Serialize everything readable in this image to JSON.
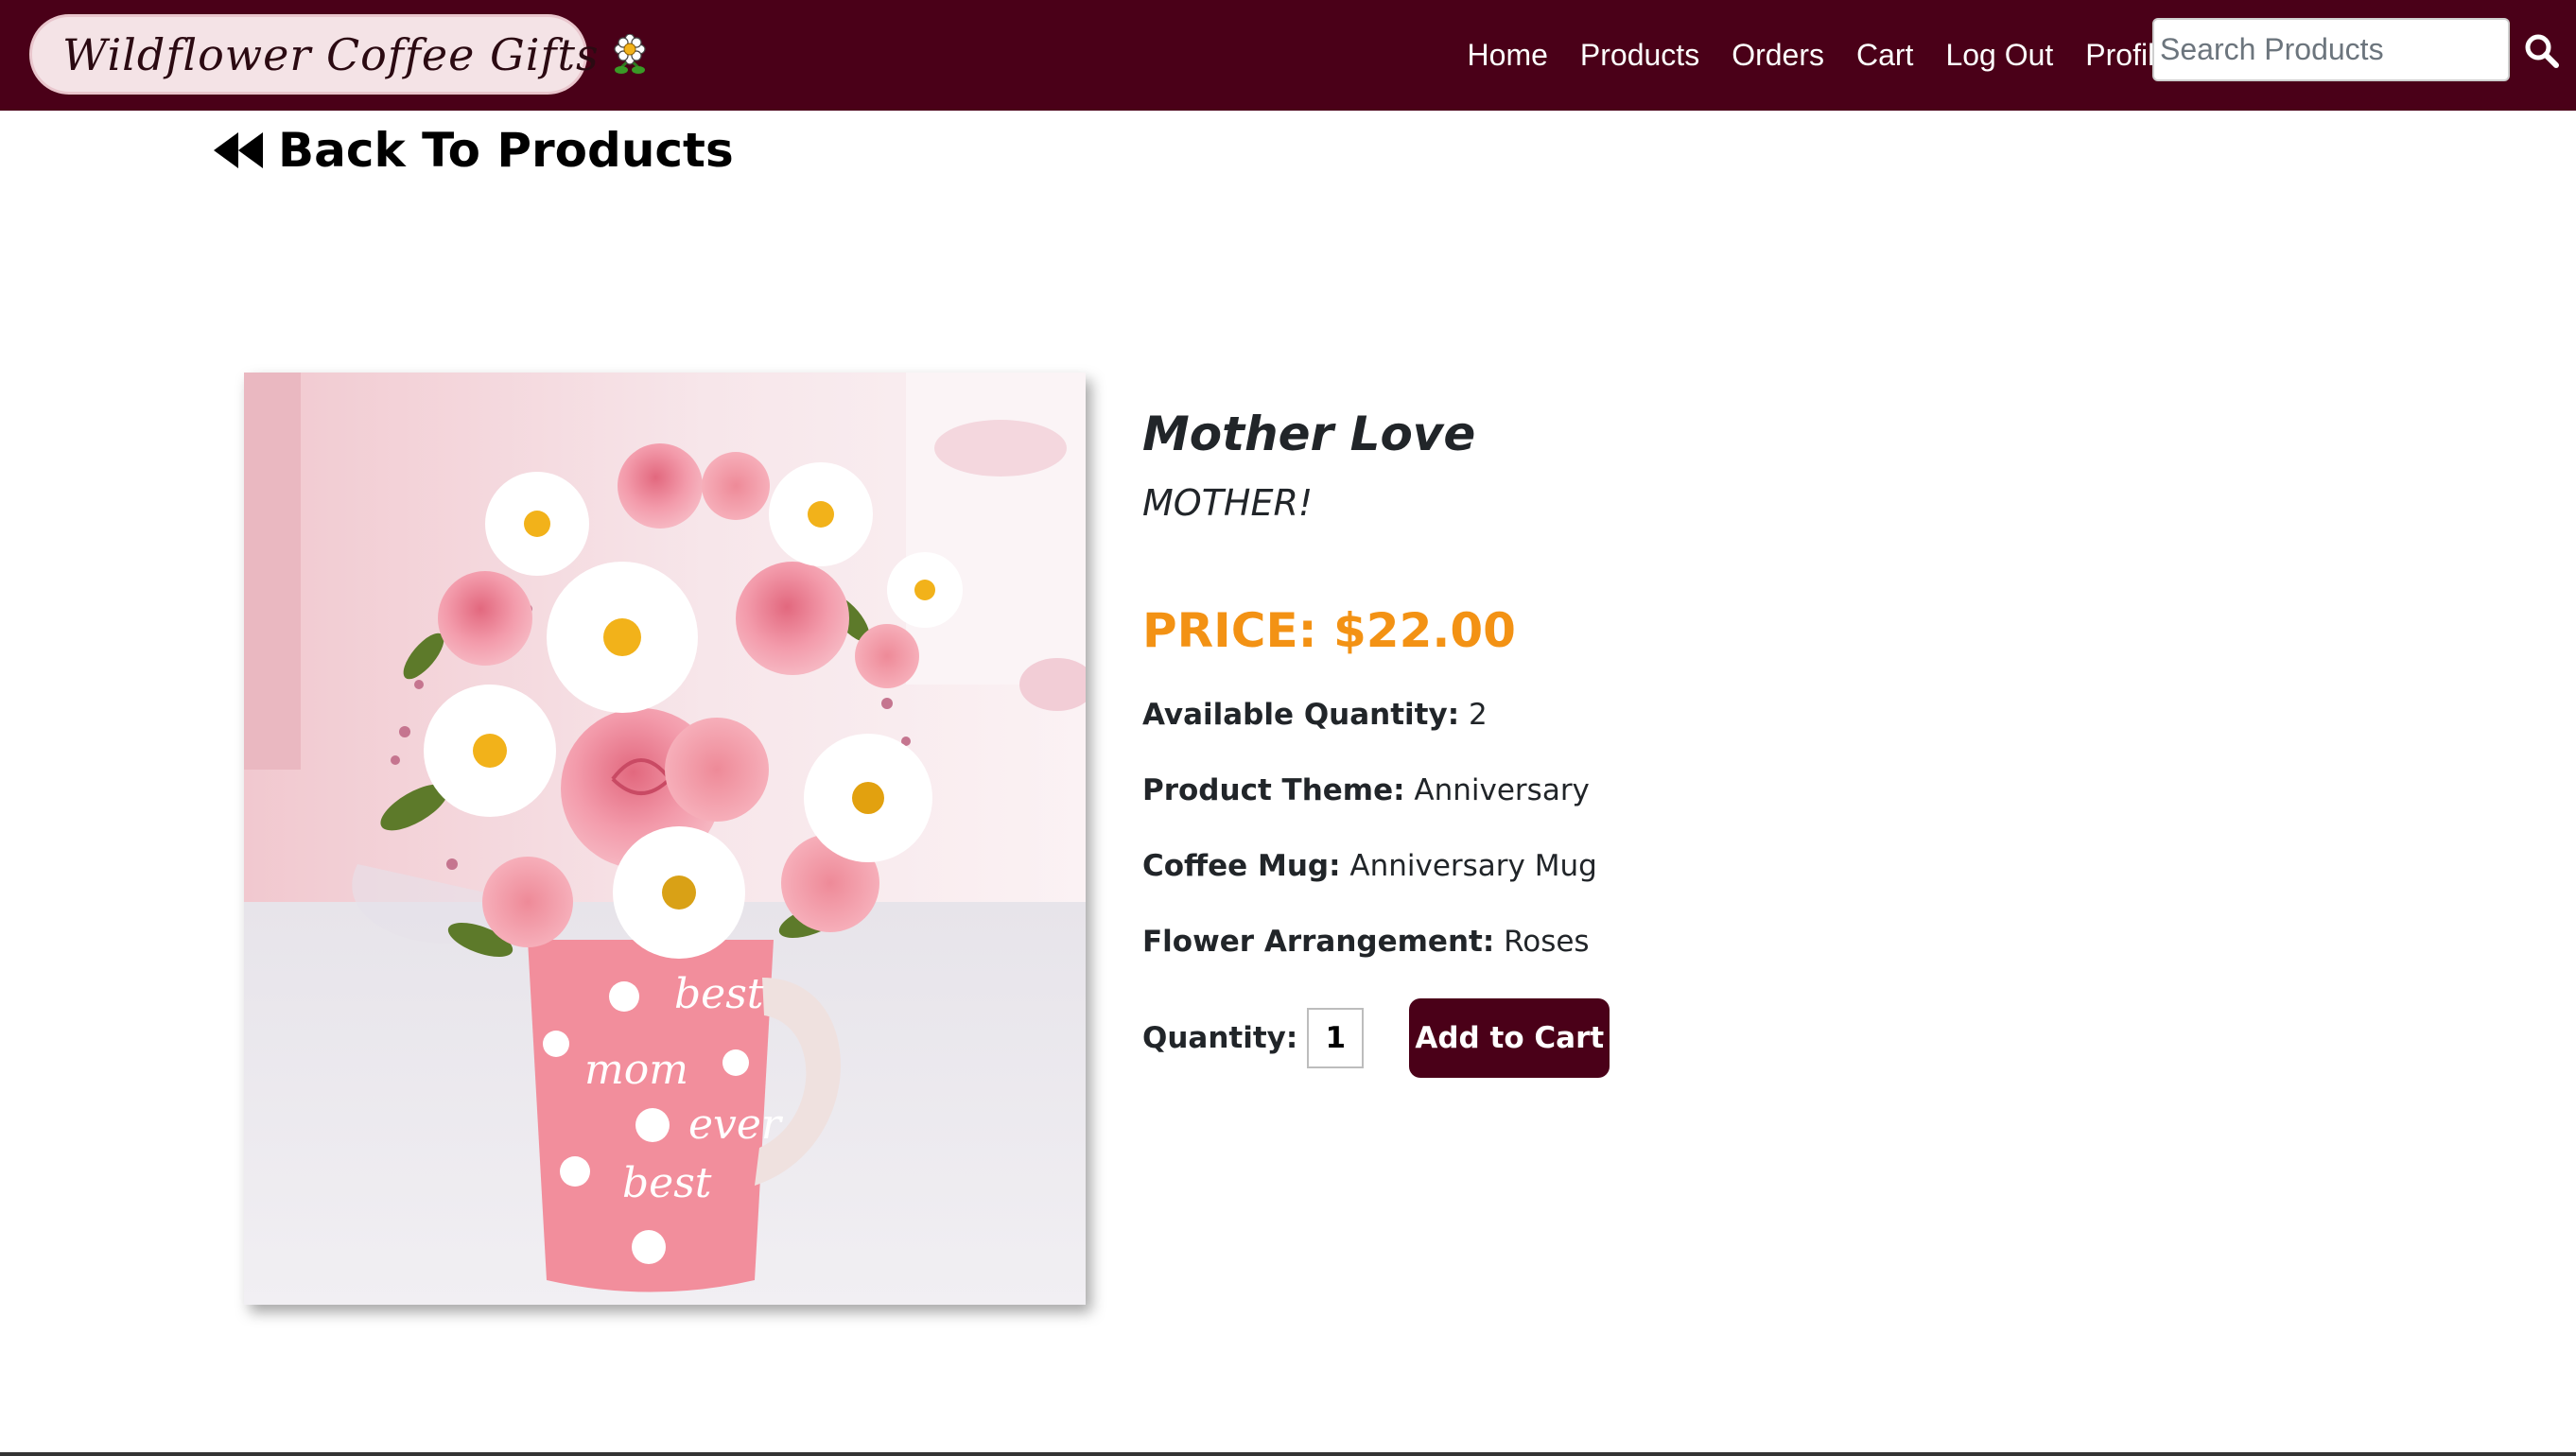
{
  "navbar": {
    "brand": "Wildflower Coffee Gifts",
    "links": [
      "Home",
      "Products",
      "Orders",
      "Cart",
      "Log Out",
      "Profile"
    ],
    "search_placeholder": "Search Products",
    "icons": {
      "brand": "flower-icon",
      "search": "search-icon"
    },
    "colors": {
      "background": "#4a0018",
      "brand_pill": "#f4e3e6"
    }
  },
  "back_link": {
    "label": "Back To Products",
    "icon": "double-left-arrow-icon"
  },
  "product": {
    "name": "Mother Love",
    "tagline": "MOTHER!",
    "price": "PRICE: $22.00",
    "price_color": "#f39214",
    "attributes": [
      {
        "label": "Available Quantity:",
        "value": "2"
      },
      {
        "label": "Product Theme:",
        "value": "Anniversary"
      },
      {
        "label": "Coffee Mug:",
        "value": "Anniversary Mug"
      },
      {
        "label": "Flower Arrangement:",
        "value": "Roses"
      }
    ],
    "quantity_label": "Quantity:",
    "quantity_value": "1",
    "add_to_cart": "Add to Cart",
    "mug_text": [
      "best",
      "mom",
      "ever",
      "best"
    ]
  }
}
